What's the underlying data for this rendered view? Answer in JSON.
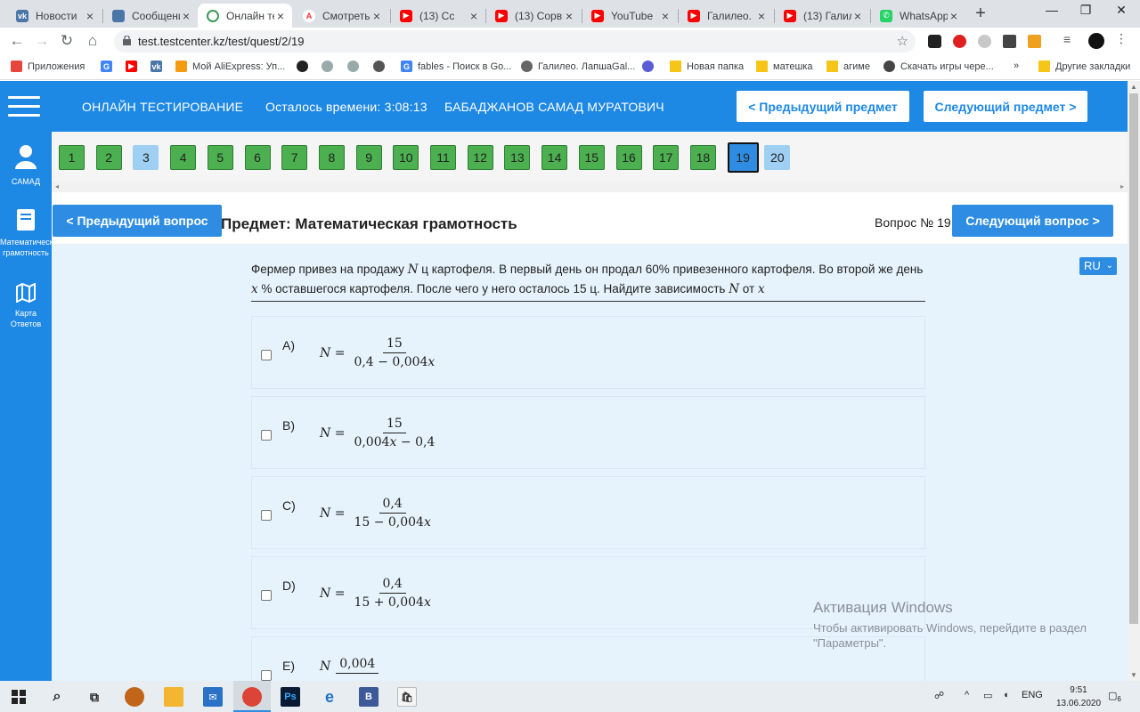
{
  "browser": {
    "tabs": [
      {
        "title": "Новости",
        "icon_color": "#4a76a8",
        "icon_text": "vk",
        "active": false
      },
      {
        "title": "Сообщени",
        "icon_color": "#4a76a8",
        "icon_text": "",
        "active": false
      },
      {
        "title": "Онлайн те",
        "icon_color": "#ffffff",
        "icon_text": "",
        "active": true
      },
      {
        "title": "Смотреть",
        "icon_color": "#ffffff",
        "icon_text": "A",
        "active": false
      },
      {
        "title": "(13) Сс",
        "icon_color": "#ff0000",
        "icon_text": "▶",
        "active": false
      },
      {
        "title": "(13) Сорви",
        "icon_color": "#ff0000",
        "icon_text": "▶",
        "active": false
      },
      {
        "title": "YouTube",
        "icon_color": "#ff0000",
        "icon_text": "▶",
        "active": false
      },
      {
        "title": "Галилео. Э",
        "icon_color": "#ff0000",
        "icon_text": "▶",
        "active": false
      },
      {
        "title": "(13) Галил",
        "icon_color": "#ff0000",
        "icon_text": "▶",
        "active": false
      },
      {
        "title": "WhatsApp",
        "icon_color": "#25d366",
        "icon_text": "✆",
        "active": false
      }
    ],
    "url": "test.testcenter.kz/test/quest/2/19",
    "bookmarks": [
      "Приложения",
      "",
      "",
      "Мой AliExpress: Уп...",
      "",
      "",
      "",
      "",
      "fables - Поиск в Go...",
      "Галилео. ЛапшаGal...",
      "",
      "Новая папка",
      "матешка",
      "агиме",
      "Скачать игры чере...",
      "»",
      "Другие закладки"
    ]
  },
  "header": {
    "title": "ОНЛАЙН ТЕСТИРОВАНИЕ",
    "time_left": "Осталось времени: 3:08:13",
    "user": "БАБАДЖАНОВ САМАД МУРАТОВИЧ",
    "prev_subject": "< Предыдущий предмет",
    "next_subject": "Следующий предмет >"
  },
  "sidebar": {
    "items": [
      {
        "label": "САМАД",
        "icon": "user-icon"
      },
      {
        "label": "Математическ грамотность",
        "icon": "book-icon"
      },
      {
        "label": "Карта Ответов",
        "icon": "map-icon"
      }
    ]
  },
  "questions": {
    "numbers": [
      "1",
      "2",
      "3",
      "4",
      "5",
      "6",
      "7",
      "8",
      "9",
      "10",
      "11",
      "12",
      "13",
      "14",
      "15",
      "16",
      "17",
      "18",
      "19",
      "20"
    ],
    "current": "19"
  },
  "question": {
    "prev_btn": "< Предыдущий вопрос",
    "next_btn": "Следующий вопрос >",
    "subject": "Предмет: Математическая грамотность",
    "number": "Вопрос № 19",
    "lang": "RU",
    "text_parts": [
      "Фермер привез на продажу",
      "N",
      "ц картофеля. В первый день он продал 60% привезенного картофеля. Во второй же день",
      "x",
      "% оставшегося картофеля. После чего у него осталось 15 ц. Найдите зависимость",
      "N",
      "от",
      "x"
    ],
    "answers": [
      {
        "letter": "A)",
        "lhs": "N =",
        "num": "15",
        "den": "0,4 − 0,004x"
      },
      {
        "letter": "B)",
        "lhs": "N =",
        "num": "15",
        "den": "0,004x − 0,4"
      },
      {
        "letter": "C)",
        "lhs": "N =",
        "num": "0,4",
        "den": "15 − 0,004x"
      },
      {
        "letter": "D)",
        "lhs": "N =",
        "num": "0,4",
        "den": "15 + 0,004x"
      },
      {
        "letter": "E)",
        "lhs": "N",
        "num": "0,004",
        "den": ""
      }
    ]
  },
  "watermark": {
    "line1": "Активация Windows",
    "line2": "Чтобы активировать Windows, перейдите в раздел \"Параметры\"."
  },
  "taskbar": {
    "lang": "ENG",
    "time": "9:51",
    "date": "13.06.2020",
    "notifications": "6"
  }
}
